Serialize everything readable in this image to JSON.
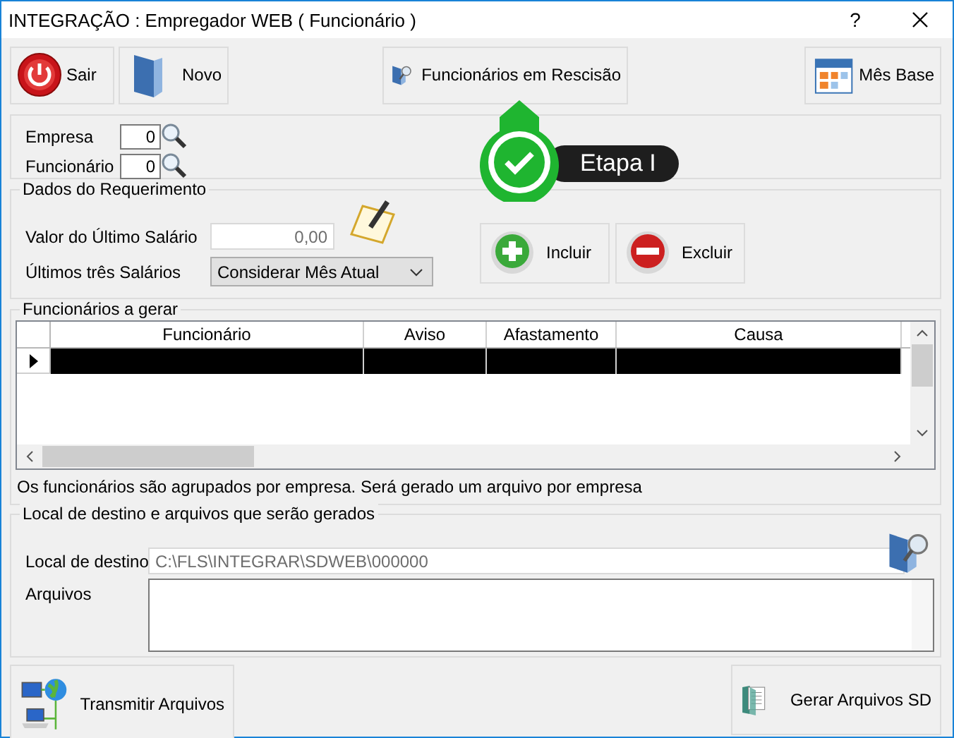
{
  "window": {
    "title": "INTEGRAÇÃO : Empregador WEB ( Funcionário )",
    "help": "?"
  },
  "toolbar": [
    {
      "label": "Sair",
      "kind": "power"
    },
    {
      "label": "Novo",
      "kind": "folder"
    },
    {
      "label": "Funcionários em Rescisão",
      "kind": "search-folder"
    },
    {
      "label": "Mês Base",
      "kind": "calendar"
    }
  ],
  "filters": [
    {
      "label": "Empresa",
      "value": "0"
    },
    {
      "label": "Funcionário",
      "value": "0"
    }
  ],
  "callout": {
    "label": "Etapa I"
  },
  "requerimento": {
    "title": "Dados do Requerimento",
    "salary_label": "Valor do Último Salário",
    "salary_value": "0,00",
    "three_label": "Últimos três Salários",
    "three_value": "Considerar Mês Atual",
    "actions": [
      {
        "label": "Incluir",
        "kind": "add"
      },
      {
        "label": "Excluir",
        "kind": "remove"
      }
    ]
  },
  "grid": {
    "title": "Funcionários a gerar",
    "columns": [
      "Funcionário",
      "Aviso",
      "Afastamento",
      "Causa"
    ],
    "rows": [
      {
        "selected": true
      }
    ],
    "note": "Os funcionários são agrupados por empresa. Será gerado um arquivo por empresa"
  },
  "destino": {
    "title": "Local de destino e arquivos que serão gerados",
    "local_label": "Local de destino",
    "local_value": "C:\\FLS\\INTEGRAR\\SDWEB\\000000",
    "files_label": "Arquivos"
  },
  "footer": [
    {
      "label": "Transmitir Arquivos",
      "kind": "network"
    },
    {
      "label": "Gerar Arquivos SD",
      "kind": "document"
    }
  ]
}
